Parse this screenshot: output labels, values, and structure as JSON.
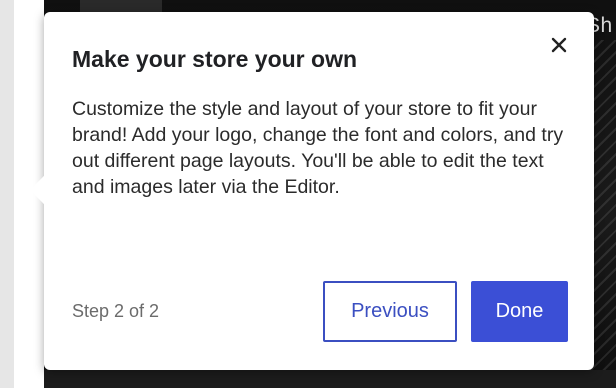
{
  "background": {
    "partial_text": "Sh"
  },
  "popover": {
    "title": "Make your store your own",
    "body": "Customize the style and layout of your store to fit your brand! Add your logo, change the font and colors, and try out different page layouts. You'll be able to edit the text and images later via the Editor.",
    "close_icon": "close-icon",
    "step_text": "Step 2 of 2",
    "previous_label": "Previous",
    "done_label": "Done"
  },
  "colors": {
    "accent": "#3b4fd6",
    "text": "#202124",
    "muted": "#6b6b6b"
  }
}
